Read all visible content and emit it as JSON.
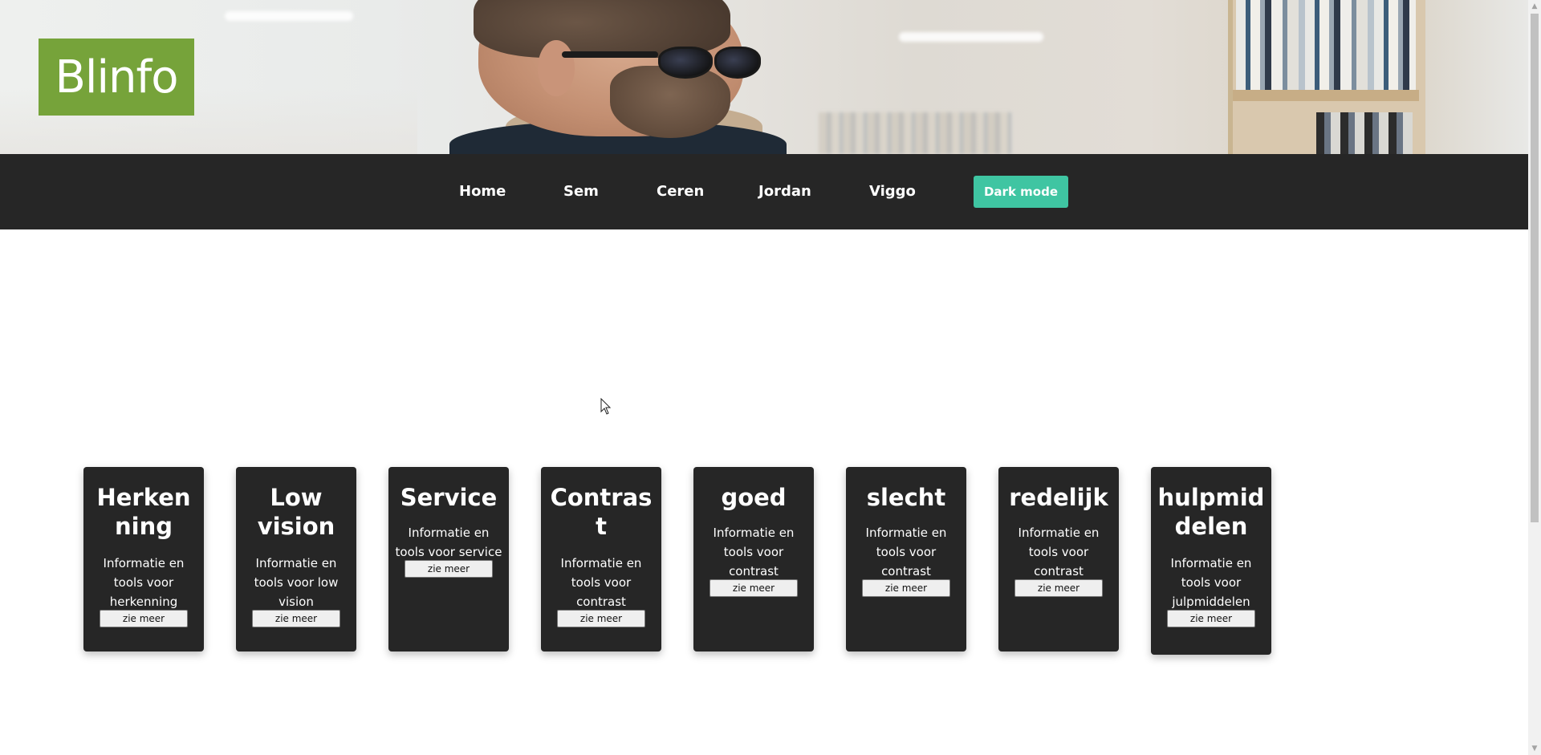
{
  "header": {
    "logo_text": "Blinfo"
  },
  "nav": {
    "items": [
      {
        "label": "Home"
      },
      {
        "label": "Sem"
      },
      {
        "label": "Ceren"
      },
      {
        "label": "Jordan"
      },
      {
        "label": "Viggo"
      }
    ],
    "dark_mode_label": "Dark mode"
  },
  "cards": [
    {
      "title": "Herkenning",
      "text": "Informatie en tools voor herkenning",
      "button": "zie meer"
    },
    {
      "title": "Low vision",
      "text": "Informatie en tools voor low vision",
      "button": "zie meer"
    },
    {
      "title": "Service",
      "text": "Informatie en tools voor service",
      "button": "zie meer"
    },
    {
      "title": "Contrast",
      "text": "Informatie en tools voor contrast",
      "button": "zie meer"
    },
    {
      "title": "goed",
      "text": "Informatie en tools voor contrast",
      "button": "zie meer"
    },
    {
      "title": "slecht",
      "text": "Informatie en tools voor contrast",
      "button": "zie meer"
    },
    {
      "title": "redelijk",
      "text": "Informatie en tools voor contrast",
      "button": "zie meer"
    },
    {
      "title": "hulpmiddelen",
      "text": "Informatie en tools voor julpmiddelen",
      "button": "zie meer"
    }
  ],
  "colors": {
    "logo_bg": "#76a33a",
    "navbar_bg": "#262626",
    "dark_mode_bg": "#3fc5a2",
    "card_bg": "#262626"
  },
  "icons": {
    "scroll_up": "scroll-up-arrow-icon",
    "scroll_down": "scroll-down-arrow-icon",
    "cursor": "mouse-cursor-icon"
  }
}
